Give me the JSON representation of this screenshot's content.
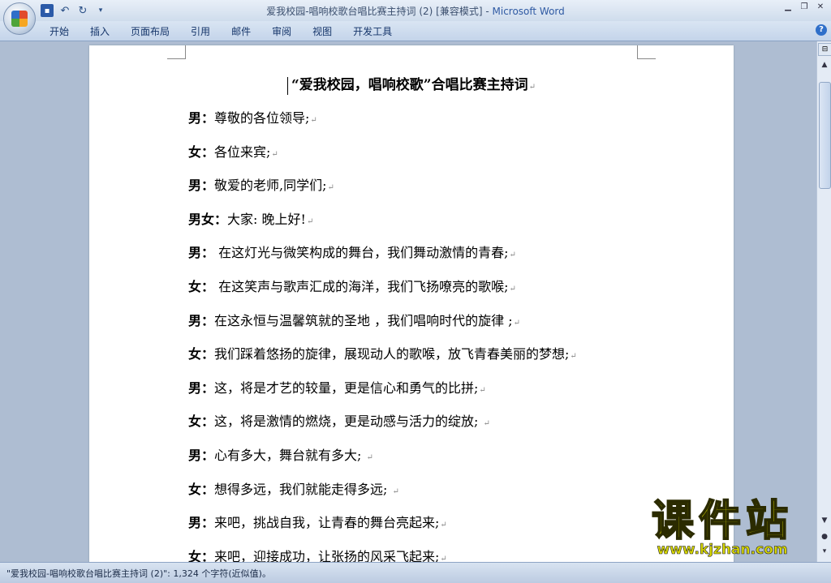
{
  "window": {
    "title_doc": "爱我校园-唱响校歌台唱比赛主持词 (2) [兼容模式] - ",
    "title_app": "Microsoft Word"
  },
  "quick_access": {
    "save_icon": "save-icon",
    "undo_icon": "undo-icon",
    "redo_icon": "redo-icon"
  },
  "ribbon": {
    "tabs": [
      "开始",
      "插入",
      "页面布局",
      "引用",
      "邮件",
      "审阅",
      "视图",
      "开发工具"
    ]
  },
  "document": {
    "title": "“爱我校园，唱响校歌”合唱比赛主持词",
    "paragraph_mark": "↵",
    "paragraphs": [
      {
        "speaker": "男：",
        "text": "尊敬的各位领导;"
      },
      {
        "speaker": "女：",
        "text": "各位来宾;"
      },
      {
        "speaker": "男：",
        "text": "敬爱的老师,同学们;"
      },
      {
        "speaker": "男女：",
        "text": "大家:  晚上好!"
      },
      {
        "speaker": "男：",
        "text": " 在这灯光与微笑构成的舞台，我们舞动激情的青春;"
      },
      {
        "speaker": "女：",
        "text": " 在这笑声与歌声汇成的海洋，我们飞扬嘹亮的歌喉;"
      },
      {
        "speaker": "男：",
        "text": "在这永恒与温馨筑就的圣地 ，我们唱响时代的旋律 ;"
      },
      {
        "speaker": "女：",
        "text": "我们踩着悠扬的旋律，展现动人的歌喉，放飞青春美丽的梦想;"
      },
      {
        "speaker": "男：",
        "text": "这，将是才艺的较量，更是信心和勇气的比拼;"
      },
      {
        "speaker": "女：",
        "text": "这，将是激情的燃烧，更是动感与活力的绽放; "
      },
      {
        "speaker": "男：",
        "text": "心有多大，舞台就有多大; "
      },
      {
        "speaker": "女：",
        "text": "想得多远，我们就能走得多远; "
      },
      {
        "speaker": "男：",
        "text": "来吧，挑战自我，让青春的舞台亮起来;"
      },
      {
        "speaker": "女：",
        "text": "来吧，迎接成功，让张扬的风采飞起来;"
      }
    ]
  },
  "status_bar": {
    "text": "\"爱我校园-唱响校歌台唱比赛主持词 (2)\": 1,324 个字符(近似值)。"
  },
  "watermark": {
    "main": "课件站",
    "url": "www.kjzhan.com"
  }
}
